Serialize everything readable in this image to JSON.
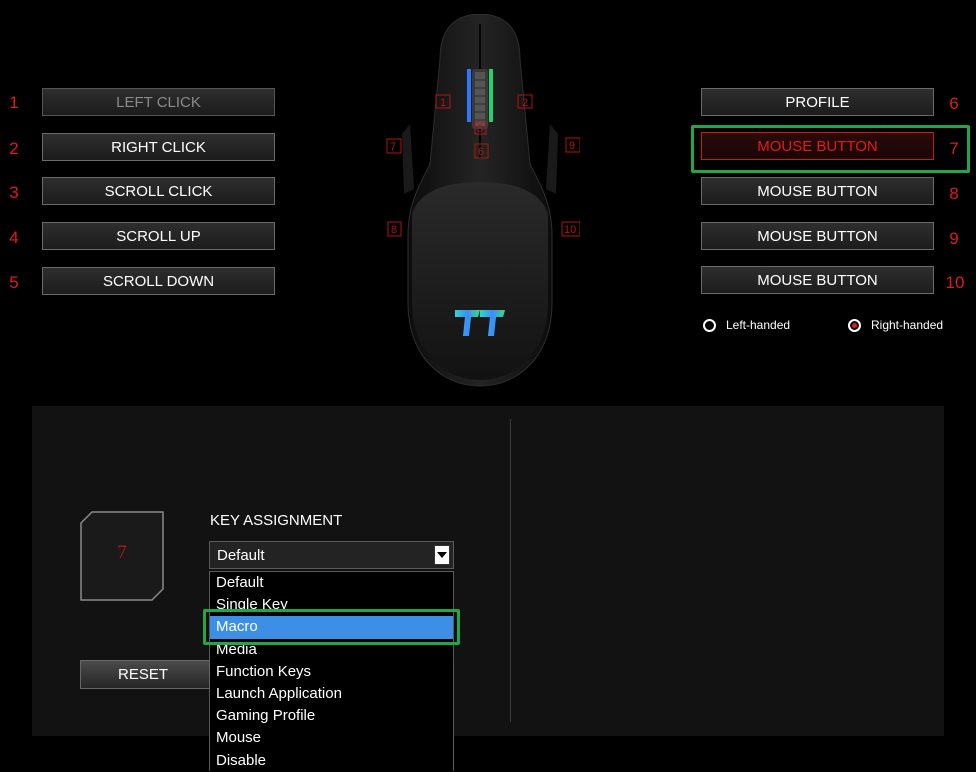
{
  "left_buttons": [
    {
      "num": "1",
      "label": "LEFT CLICK"
    },
    {
      "num": "2",
      "label": "RIGHT CLICK"
    },
    {
      "num": "3",
      "label": "SCROLL CLICK"
    },
    {
      "num": "4",
      "label": "SCROLL UP"
    },
    {
      "num": "5",
      "label": "SCROLL DOWN"
    }
  ],
  "right_buttons": [
    {
      "num": "6",
      "label": "PROFILE"
    },
    {
      "num": "7",
      "label": "MOUSE BUTTON"
    },
    {
      "num": "8",
      "label": "MOUSE BUTTON"
    },
    {
      "num": "9",
      "label": "MOUSE BUTTON"
    },
    {
      "num": "10",
      "label": "MOUSE BUTTON"
    }
  ],
  "handedness": {
    "left": "Left-handed",
    "right": "Right-handed",
    "selected": "right"
  },
  "mouse_markers": [
    "1",
    "2",
    "5",
    "6",
    "7",
    "8",
    "9",
    "10"
  ],
  "key_assignment": {
    "tile_number": "7",
    "label": "KEY ASSIGNMENT",
    "selected": "Default",
    "options": [
      "Default",
      "Single Key",
      "Macro",
      "Media",
      "Function Keys",
      "Launch Application",
      "Gaming Profile",
      "Mouse",
      "Disable"
    ],
    "highlighted": "Macro"
  },
  "reset_label": "RESET",
  "colors": {
    "accent_red": "#e01b1b",
    "highlight_green": "#22a64a",
    "selection_blue": "#3d8fe6"
  }
}
